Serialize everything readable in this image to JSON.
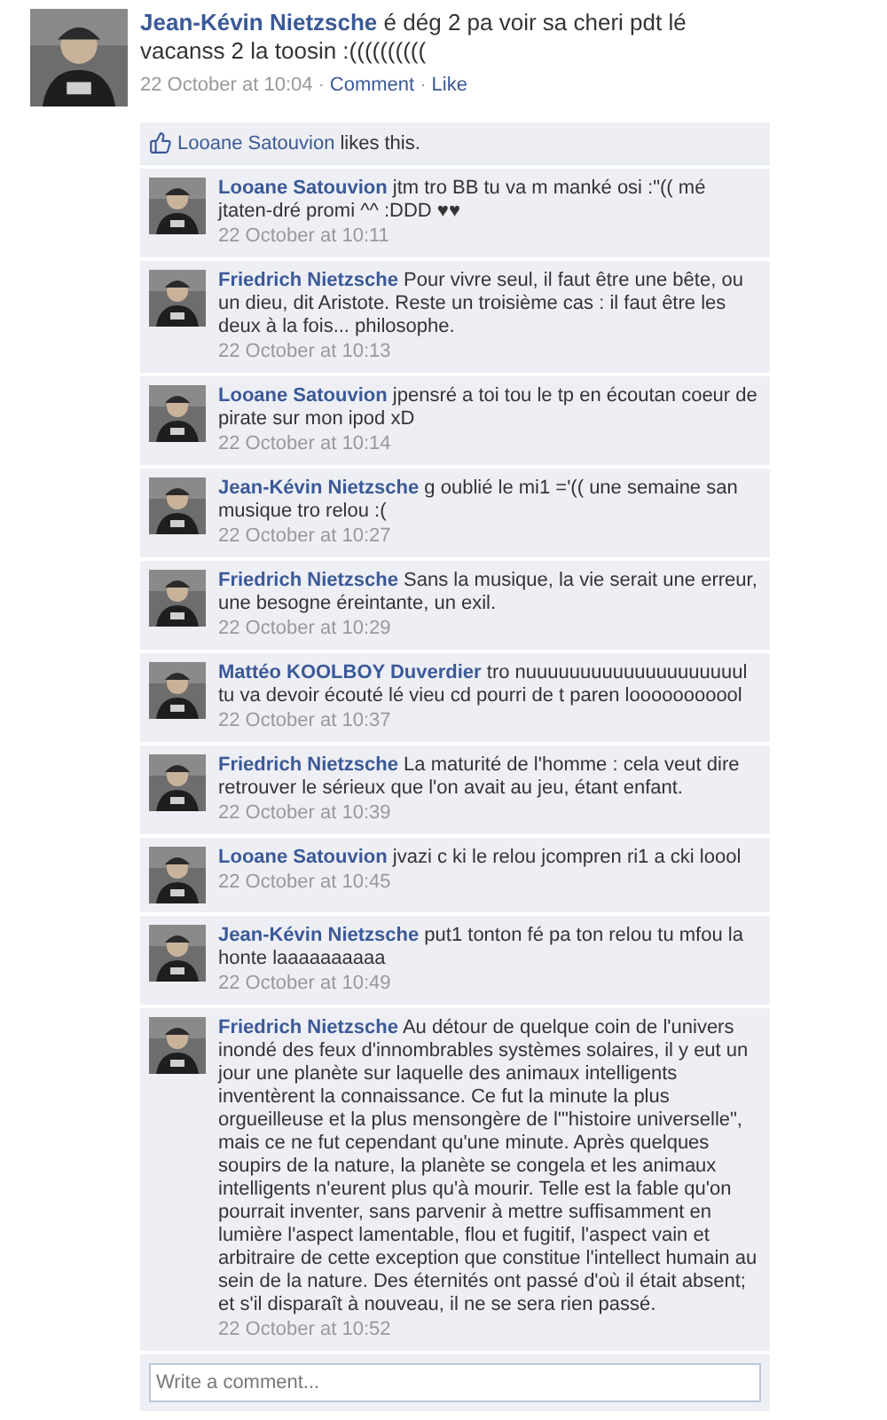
{
  "post": {
    "author": "Jean-Kévin Nietzsche",
    "text": "é dég 2 pa voir sa cheri pdt lé vacanss 2 la toosin :((((((((((",
    "time": "22 October at 10:04",
    "separator": "·",
    "actions": [
      "Comment",
      "Like"
    ]
  },
  "likes": {
    "name": "Looane Satouvion",
    "text": "likes this."
  },
  "comments": [
    {
      "author": "Looane Satouvion",
      "text": "jtm tro BB tu va m manké osi :\"(( mé jtaten-dré promi ^^ :DDD ♥♥",
      "time": "22 October at 10:11"
    },
    {
      "author": "Friedrich Nietzsche",
      "text": "Pour vivre seul, il faut être une bête, ou un dieu, dit Aristote. Reste un troisième cas : il faut être les deux à la fois... philosophe.",
      "time": "22 October at 10:13"
    },
    {
      "author": "Looane Satouvion",
      "text": "jpensré a toi tou le tp en écoutan coeur de pirate sur mon ipod xD",
      "time": "22 October at 10:14"
    },
    {
      "author": "Jean-Kévin Nietzsche",
      "text": "g oublié le mi1 ='(( une semaine san musique tro relou :(",
      "time": "22 October at 10:27"
    },
    {
      "author": "Friedrich Nietzsche",
      "text": "Sans la musique, la vie serait une erreur, une besogne éreintante, un exil.",
      "time": "22 October at 10:29"
    },
    {
      "author": "Mattéo KOOLBOY Duverdier",
      "text": "tro nuuuuuuuuuuuuuuuuuuuul tu va devoir écouté lé vieu cd pourri de t paren looooooooool",
      "time": "22 October at 10:37"
    },
    {
      "author": "Friedrich Nietzsche",
      "text": "La maturité de l'homme : cela veut dire retrouver le sérieux que l'on avait au jeu, étant enfant.",
      "time": "22 October at 10:39"
    },
    {
      "author": "Looane Satouvion",
      "text": "jvazi c ki le relou jcompren ri1 a cki loool",
      "time": "22 October at 10:45"
    },
    {
      "author": "Jean-Kévin Nietzsche",
      "text": "put1 tonton fé pa ton relou tu mfou la honte laaaaaaaaaa",
      "time": "22 October at 10:49"
    },
    {
      "author": "Friedrich Nietzsche",
      "text": "Au détour de quelque coin de l'univers inondé des feux d'innombrables systèmes solaires, il y eut un jour une planète sur laquelle des animaux intelligents inventèrent la connaissance. Ce fut la minute la plus orgueilleuse et la plus mensongère de l'\"histoire universelle\", mais ce ne fut cependant qu'une minute. Après quelques soupirs de la nature, la planète se congela et les animaux intelligents n'eurent plus qu'à mourir. Telle est la fable qu'on pourrait inventer, sans parvenir à mettre suffisamment en lumière l'aspect lamentable, flou et fugitif, l'aspect vain et arbitraire de cette exception que constitue l'intellect humain au sein de la nature. Des éternités ont passé d'où il était absent; et s'il disparaît à nouveau, il ne se sera rien passé.",
      "time": "22 October at 10:52"
    }
  ],
  "comment_field": {
    "placeholder": "Write a comment..."
  }
}
